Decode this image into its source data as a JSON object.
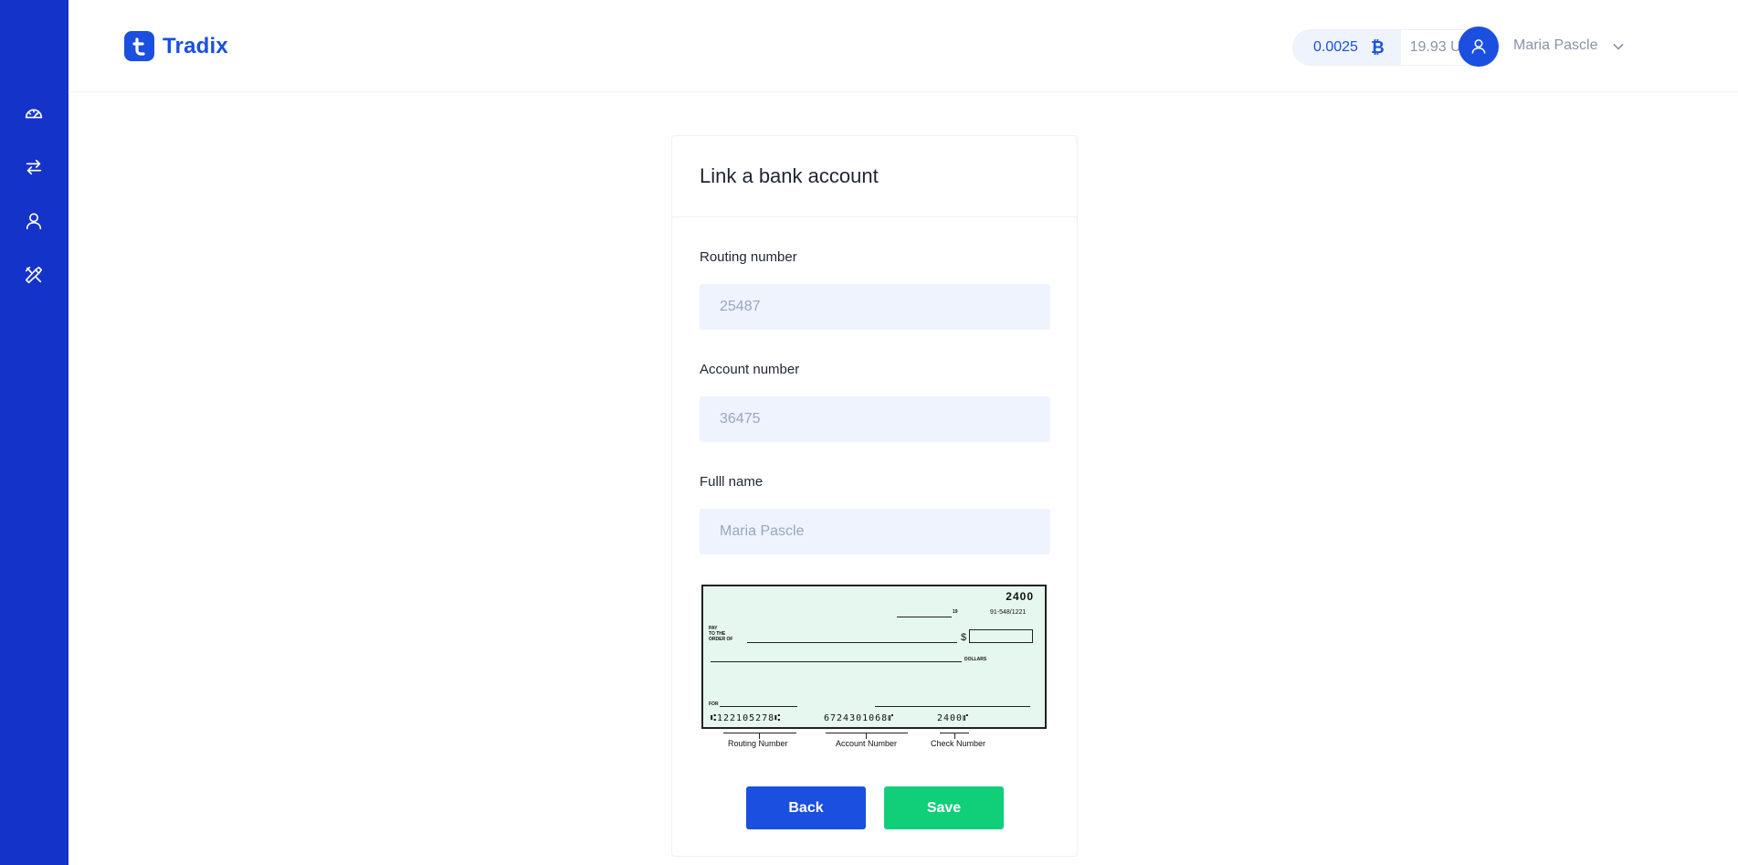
{
  "brand": {
    "name": "Tradix"
  },
  "header": {
    "btc_balance": "0.0025",
    "btc_symbol": "₿",
    "usd_balance": "19.93 USD",
    "user_name": "Maria Pascle"
  },
  "sidebar": {
    "items": [
      {
        "name": "dashboard",
        "icon": "gauge-icon"
      },
      {
        "name": "transfer",
        "icon": "arrows-exchange-icon"
      },
      {
        "name": "profile",
        "icon": "user-icon"
      },
      {
        "name": "settings",
        "icon": "tools-icon"
      }
    ]
  },
  "form": {
    "title": "Link a bank account",
    "routing_label": "Routing number",
    "routing_placeholder": "25487",
    "account_label": "Account number",
    "account_placeholder": "36475",
    "name_label": "Fulll name",
    "name_placeholder": "Maria Pascle",
    "back_label": "Back",
    "save_label": "Save"
  },
  "check": {
    "number": "2400",
    "date_suffix": "19",
    "bank_code": "91-548/1221",
    "pay_to_line1": "PAY",
    "pay_to_line2": "TO THE",
    "pay_to_line3": "ORDER OF",
    "dollar_sign": "$",
    "dollars_label": "DOLLARS",
    "for_label": "FOR",
    "micr_routing": "⑆122105278⑆",
    "micr_account": "6724301068⑈",
    "micr_check": "2400⑈",
    "routing_caption": "Routing Number",
    "account_caption": "Account Number",
    "check_caption": "Check Number"
  },
  "colors": {
    "sidebar": "#1433c9",
    "accent": "#1a4fe0",
    "success": "#10cf78",
    "input_bg": "#eef3fe"
  }
}
